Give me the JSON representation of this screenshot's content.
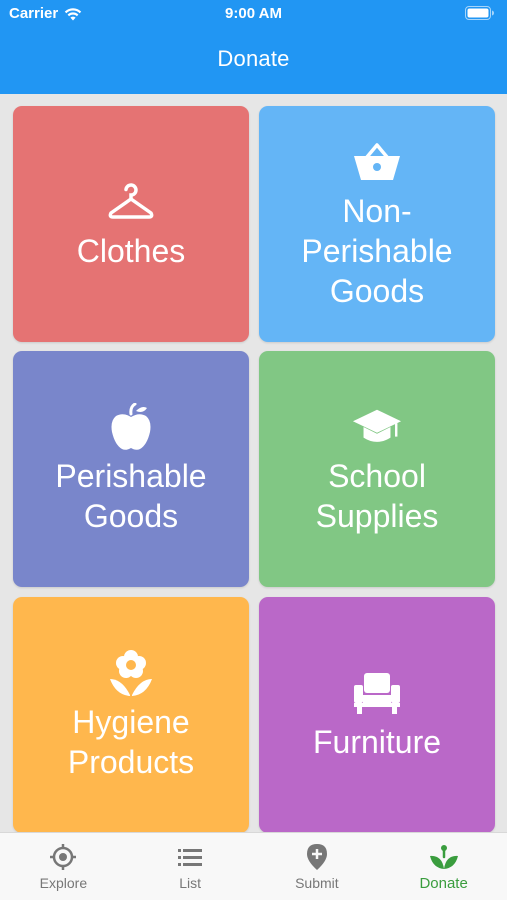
{
  "status_bar": {
    "carrier": "Carrier",
    "time": "9:00 AM"
  },
  "nav": {
    "title": "Donate"
  },
  "categories": [
    {
      "label": "Clothes",
      "icon": "hanger-icon",
      "color": "#e57373"
    },
    {
      "label": "Non-\nPerishable\nGoods",
      "icon": "basket-icon",
      "color": "#64b5f6"
    },
    {
      "label": "Perishable\nGoods",
      "icon": "apple-icon",
      "color": "#7986cb"
    },
    {
      "label": "School\nSupplies",
      "icon": "graduation-cap-icon",
      "color": "#81c784"
    },
    {
      "label": "Hygiene\nProducts",
      "icon": "flower-icon",
      "color": "#ffb74d"
    },
    {
      "label": "Furniture",
      "icon": "armchair-icon",
      "color": "#ba68c8"
    }
  ],
  "tabbar": {
    "tabs": [
      {
        "label": "Explore",
        "icon": "crosshair-icon"
      },
      {
        "label": "List",
        "icon": "list-icon"
      },
      {
        "label": "Submit",
        "icon": "map-pin-plus-icon"
      },
      {
        "label": "Donate",
        "icon": "sprout-icon"
      }
    ],
    "active": "Donate",
    "active_color": "#3a9d3e",
    "inactive_color": "#777777"
  },
  "theme": {
    "header_color": "#2196f3",
    "background": "#e6e6e6"
  }
}
